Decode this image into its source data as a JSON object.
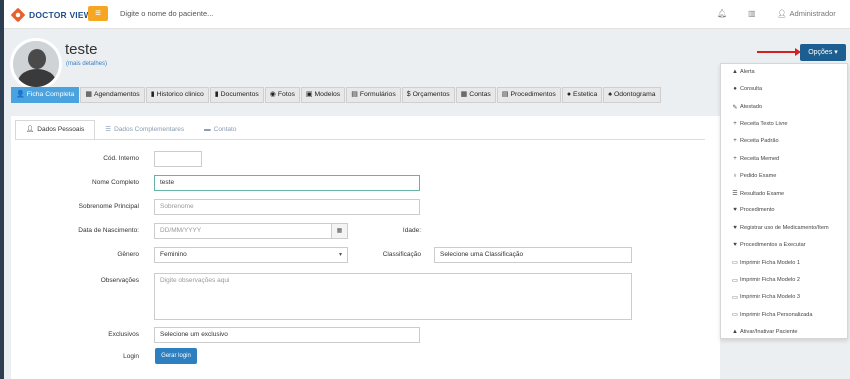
{
  "topbar": {
    "logo_text": "DOCTOR VIEW",
    "menu_icon": "bars-icon",
    "search_placeholder": "Digite o nome do paciente...",
    "user_label": "Administrador"
  },
  "patient": {
    "name": "teste",
    "more_details": "(mais detalhes)"
  },
  "options_button": "Opções",
  "tabs": [
    {
      "label": "Ficha Completa",
      "icon": "user-icon",
      "glyph": "👤"
    },
    {
      "label": "Agendamentos",
      "icon": "calendar-icon",
      "glyph": "▦"
    },
    {
      "label": "Historico clinico",
      "icon": "file-icon",
      "glyph": "▮"
    },
    {
      "label": "Documentos",
      "icon": "document-icon",
      "glyph": "▮"
    },
    {
      "label": "Fotos",
      "icon": "camera-icon",
      "glyph": "◉"
    },
    {
      "label": "Modelos",
      "icon": "image-icon",
      "glyph": "▣"
    },
    {
      "label": "Formulários",
      "icon": "list-icon",
      "glyph": "▤"
    },
    {
      "label": "Orçamentos",
      "icon": "dollar-icon",
      "glyph": "$"
    },
    {
      "label": "Contas",
      "icon": "calculator-icon",
      "glyph": "▦"
    },
    {
      "label": "Procedimentos",
      "icon": "clipboard-icon",
      "glyph": "▤"
    },
    {
      "label": "Estetica",
      "icon": "smile-icon",
      "glyph": "●"
    },
    {
      "label": "Odontograma",
      "icon": "tooth-icon",
      "glyph": "♠"
    }
  ],
  "subtabs": [
    {
      "label": "Dados Pessoais",
      "icon": "user-icon"
    },
    {
      "label": "Dados Complementares",
      "icon": "list-icon"
    },
    {
      "label": "Contato",
      "icon": "card-icon"
    }
  ],
  "form": {
    "cod_interno_label": "Cód. Interno",
    "cod_interno_value": "",
    "nome_label": "Nome Completo",
    "nome_value": "teste",
    "sobrenome_label": "Sobrenome Principal",
    "sobrenome_placeholder": "Sobrenome",
    "nascimento_label": "Data de Nascimento:",
    "nascimento_placeholder": "DD/MM/YYYY",
    "idade_label": "Idade:",
    "genero_label": "Gênero",
    "genero_value": "Feminino",
    "classificacao_label": "Classificação",
    "classificacao_placeholder": "Selecione uma Classificação",
    "observacoes_label": "Observações",
    "observacoes_placeholder": "Digite observações aqui",
    "exclusivos_label": "Exclusivos",
    "exclusivos_placeholder": "Selecione um exclusivo",
    "login_label": "Login",
    "gerar_login": "Gerar login"
  },
  "dropdown_items": [
    {
      "label": "Alerta",
      "icon": "warning-icon",
      "glyph": "▲"
    },
    {
      "label": "Consulta",
      "icon": "user-icon",
      "glyph": "●"
    },
    {
      "label": "Atestado",
      "icon": "edit-icon",
      "glyph": "✎"
    },
    {
      "label": "Receita Texto Livre",
      "icon": "plus-icon",
      "glyph": "+"
    },
    {
      "label": "Receita Padrão",
      "icon": "plus-icon",
      "glyph": "+"
    },
    {
      "label": "Receita Memed",
      "icon": "plus-icon",
      "glyph": "+"
    },
    {
      "label": "Pedido Exame",
      "icon": "stethoscope-icon",
      "glyph": "♁"
    },
    {
      "label": "Resultado Exame",
      "icon": "list-icon",
      "glyph": "☰"
    },
    {
      "label": "Procedimento",
      "icon": "heart-icon",
      "glyph": "♥"
    },
    {
      "label": "Registrar uso de Medicamento/Item",
      "icon": "heart-icon",
      "glyph": "♥"
    },
    {
      "label": "Procedimentos a Executar",
      "icon": "heart-icon",
      "glyph": "♥"
    },
    {
      "label": "Imprimir Ficha Modelo 1",
      "icon": "print-icon",
      "glyph": "▭"
    },
    {
      "label": "Imprimir Ficha Modelo 2",
      "icon": "print-icon",
      "glyph": "▭"
    },
    {
      "label": "Imprimir Ficha Modelo 3",
      "icon": "print-icon",
      "glyph": "▭"
    },
    {
      "label": "Imprimir Ficha Personalizada",
      "icon": "print-icon",
      "glyph": "▭"
    },
    {
      "label": "Ativar/Inativar Paciente",
      "icon": "warning-icon",
      "glyph": "▲"
    }
  ]
}
